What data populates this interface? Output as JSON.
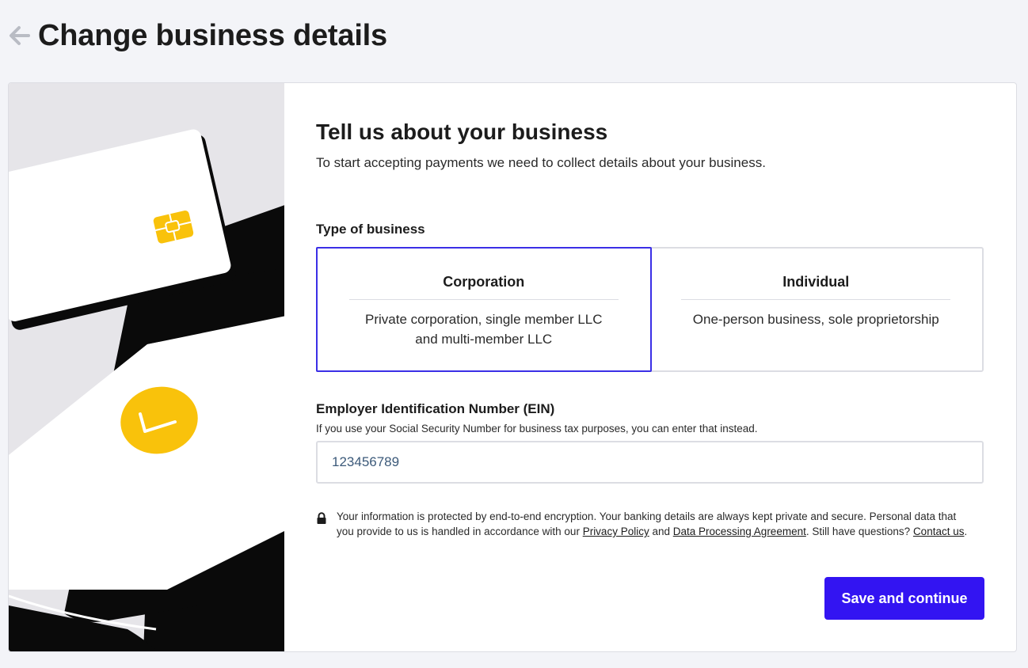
{
  "header": {
    "title": "Change business details",
    "back_icon": "arrow-left-icon"
  },
  "form": {
    "title": "Tell us about your business",
    "subtitle": "To start accepting payments we need to collect details about your business.",
    "business_type": {
      "label": "Type of business",
      "selected": "Corporation",
      "options": [
        {
          "title": "Corporation",
          "desc_line1": "Private corporation, single member LLC",
          "desc_line2": "and multi-member LLC"
        },
        {
          "title": "Individual",
          "desc_line1": "One-person business, sole proprietorship",
          "desc_line2": ""
        }
      ]
    },
    "ein": {
      "label": "Employer Identification Number (EIN)",
      "help": "If you use your Social Security Number for business tax purposes, you can enter that instead.",
      "value": "123456789"
    },
    "privacy": {
      "text_1": "Your information is protected by end-to-end encryption. Your banking details are always kept private and secure. Personal data that you provide to us is handled in accordance with our ",
      "privacy_link": "Privacy Policy",
      "text_2": " and ",
      "dpa_link": "Data Processing Agreement",
      "text_3": ". Still have questions? ",
      "contact_link": "Contact us",
      "text_4": "."
    },
    "save_label": "Save and continue"
  },
  "colors": {
    "accent": "#3314f2",
    "selected_border": "#3b2fe6",
    "chip_yellow": "#f9c20b",
    "illustration_bg": "#e6e5e9"
  }
}
